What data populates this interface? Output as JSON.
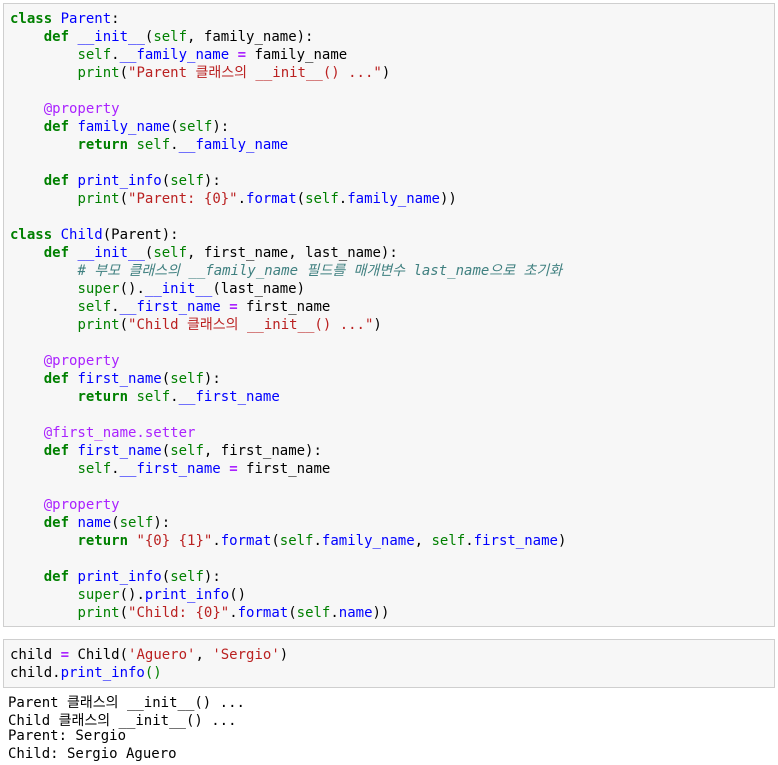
{
  "cells": [
    {
      "lines": [
        [
          [
            "kw",
            "class"
          ],
          [
            "t",
            " "
          ],
          [
            "cls",
            "Parent"
          ],
          [
            "t",
            ":"
          ]
        ],
        [
          [
            "t",
            "    "
          ],
          [
            "kw",
            "def"
          ],
          [
            "t",
            " "
          ],
          [
            "fn",
            "__init__"
          ],
          [
            "t",
            "("
          ],
          [
            "self",
            "self"
          ],
          [
            "t",
            ", family_name):"
          ]
        ],
        [
          [
            "t",
            "        "
          ],
          [
            "self",
            "self"
          ],
          [
            "t",
            "."
          ],
          [
            "attr",
            "__family_name"
          ],
          [
            "t",
            " "
          ],
          [
            "op",
            "="
          ],
          [
            "t",
            " family_name"
          ]
        ],
        [
          [
            "t",
            "        "
          ],
          [
            "bi",
            "print"
          ],
          [
            "t",
            "("
          ],
          [
            "st",
            "\"Parent 클래스의 __init__() ...\""
          ],
          [
            "t",
            ")"
          ]
        ],
        [
          [
            "t",
            ""
          ]
        ],
        [
          [
            "t",
            "    "
          ],
          [
            "dec",
            "@property"
          ]
        ],
        [
          [
            "t",
            "    "
          ],
          [
            "kw",
            "def"
          ],
          [
            "t",
            " "
          ],
          [
            "fn",
            "family_name"
          ],
          [
            "t",
            "("
          ],
          [
            "self",
            "self"
          ],
          [
            "t",
            "):"
          ]
        ],
        [
          [
            "t",
            "        "
          ],
          [
            "kw",
            "return"
          ],
          [
            "t",
            " "
          ],
          [
            "self",
            "self"
          ],
          [
            "t",
            "."
          ],
          [
            "attr",
            "__family_name"
          ]
        ],
        [
          [
            "t",
            ""
          ]
        ],
        [
          [
            "t",
            "    "
          ],
          [
            "kw",
            "def"
          ],
          [
            "t",
            " "
          ],
          [
            "fn",
            "print_info"
          ],
          [
            "t",
            "("
          ],
          [
            "self",
            "self"
          ],
          [
            "t",
            "):"
          ]
        ],
        [
          [
            "t",
            "        "
          ],
          [
            "bi",
            "print"
          ],
          [
            "t",
            "("
          ],
          [
            "st",
            "\"Parent: {0}\""
          ],
          [
            "t",
            "."
          ],
          [
            "attr",
            "format"
          ],
          [
            "t",
            "("
          ],
          [
            "self",
            "self"
          ],
          [
            "t",
            "."
          ],
          [
            "attr",
            "family_name"
          ],
          [
            "t",
            "))"
          ]
        ],
        [
          [
            "t",
            ""
          ]
        ],
        [
          [
            "kw",
            "class"
          ],
          [
            "t",
            " "
          ],
          [
            "cls",
            "Child"
          ],
          [
            "t",
            "(Parent):"
          ]
        ],
        [
          [
            "t",
            "    "
          ],
          [
            "kw",
            "def"
          ],
          [
            "t",
            " "
          ],
          [
            "fn",
            "__init__"
          ],
          [
            "t",
            "("
          ],
          [
            "self",
            "self"
          ],
          [
            "t",
            ", first_name, last_name):"
          ]
        ],
        [
          [
            "t",
            "        "
          ],
          [
            "cm",
            "# 부모 클래스의 __family_name 필드를 매개변수 last_name으로 초기화"
          ]
        ],
        [
          [
            "t",
            "        "
          ],
          [
            "bi",
            "super"
          ],
          [
            "t",
            "()."
          ],
          [
            "attr",
            "__init__"
          ],
          [
            "t",
            "(last_name)"
          ]
        ],
        [
          [
            "t",
            "        "
          ],
          [
            "self",
            "self"
          ],
          [
            "t",
            "."
          ],
          [
            "attr",
            "__first_name"
          ],
          [
            "t",
            " "
          ],
          [
            "op",
            "="
          ],
          [
            "t",
            " first_name"
          ]
        ],
        [
          [
            "t",
            "        "
          ],
          [
            "bi",
            "print"
          ],
          [
            "t",
            "("
          ],
          [
            "st",
            "\"Child 클래스의 __init__() ...\""
          ],
          [
            "t",
            ")"
          ]
        ],
        [
          [
            "t",
            ""
          ]
        ],
        [
          [
            "t",
            "    "
          ],
          [
            "dec",
            "@property"
          ]
        ],
        [
          [
            "t",
            "    "
          ],
          [
            "kw",
            "def"
          ],
          [
            "t",
            " "
          ],
          [
            "fn",
            "first_name"
          ],
          [
            "t",
            "("
          ],
          [
            "self",
            "self"
          ],
          [
            "t",
            "):"
          ]
        ],
        [
          [
            "t",
            "        "
          ],
          [
            "kw",
            "return"
          ],
          [
            "t",
            " "
          ],
          [
            "self",
            "self"
          ],
          [
            "t",
            "."
          ],
          [
            "attr",
            "__first_name"
          ]
        ],
        [
          [
            "t",
            ""
          ]
        ],
        [
          [
            "t",
            "    "
          ],
          [
            "dec",
            "@first_name.setter"
          ]
        ],
        [
          [
            "t",
            "    "
          ],
          [
            "kw",
            "def"
          ],
          [
            "t",
            " "
          ],
          [
            "fn",
            "first_name"
          ],
          [
            "t",
            "("
          ],
          [
            "self",
            "self"
          ],
          [
            "t",
            ", first_name):"
          ]
        ],
        [
          [
            "t",
            "        "
          ],
          [
            "self",
            "self"
          ],
          [
            "t",
            "."
          ],
          [
            "attr",
            "__first_name"
          ],
          [
            "t",
            " "
          ],
          [
            "op",
            "="
          ],
          [
            "t",
            " first_name"
          ]
        ],
        [
          [
            "t",
            ""
          ]
        ],
        [
          [
            "t",
            "    "
          ],
          [
            "dec",
            "@property"
          ]
        ],
        [
          [
            "t",
            "    "
          ],
          [
            "kw",
            "def"
          ],
          [
            "t",
            " "
          ],
          [
            "fn",
            "name"
          ],
          [
            "t",
            "("
          ],
          [
            "self",
            "self"
          ],
          [
            "t",
            "):"
          ]
        ],
        [
          [
            "t",
            "        "
          ],
          [
            "kw",
            "return"
          ],
          [
            "t",
            " "
          ],
          [
            "st",
            "\"{0} {1}\""
          ],
          [
            "t",
            "."
          ],
          [
            "attr",
            "format"
          ],
          [
            "t",
            "("
          ],
          [
            "self",
            "self"
          ],
          [
            "t",
            "."
          ],
          [
            "attr",
            "family_name"
          ],
          [
            "t",
            ", "
          ],
          [
            "self",
            "self"
          ],
          [
            "t",
            "."
          ],
          [
            "attr",
            "first_name"
          ],
          [
            "t",
            ")"
          ]
        ],
        [
          [
            "t",
            ""
          ]
        ],
        [
          [
            "t",
            "    "
          ],
          [
            "kw",
            "def"
          ],
          [
            "t",
            " "
          ],
          [
            "fn",
            "print_info"
          ],
          [
            "t",
            "("
          ],
          [
            "self",
            "self"
          ],
          [
            "t",
            "):"
          ]
        ],
        [
          [
            "t",
            "        "
          ],
          [
            "bi",
            "super"
          ],
          [
            "t",
            "()."
          ],
          [
            "attr",
            "print_info"
          ],
          [
            "t",
            "()"
          ]
        ],
        [
          [
            "t",
            "        "
          ],
          [
            "bi",
            "print"
          ],
          [
            "t",
            "("
          ],
          [
            "st",
            "\"Child: {0}\""
          ],
          [
            "t",
            "."
          ],
          [
            "attr",
            "format"
          ],
          [
            "t",
            "("
          ],
          [
            "self",
            "self"
          ],
          [
            "t",
            "."
          ],
          [
            "attr",
            "name"
          ],
          [
            "t",
            "))"
          ]
        ]
      ]
    },
    {
      "lines": [
        [
          [
            "t",
            "child "
          ],
          [
            "op",
            "="
          ],
          [
            "t",
            " Child("
          ],
          [
            "st",
            "'Aguero'"
          ],
          [
            "t",
            ", "
          ],
          [
            "st",
            "'Sergio'"
          ],
          [
            "t",
            ")"
          ]
        ],
        [
          [
            "t",
            "child."
          ],
          [
            "attr",
            "print_info"
          ],
          [
            "bi",
            "()"
          ]
        ]
      ]
    }
  ],
  "output": [
    "Parent 클래스의 __init__() ...",
    "Child 클래스의 __init__() ...",
    "Parent: Sergio",
    "Child: Sergio Aguero"
  ],
  "colors": {
    "keyword": "#008000",
    "name": "#0000ff",
    "operator": "#aa22ff",
    "string": "#ba2121",
    "comment": "#408080",
    "cell_bg": "#f7f7f7",
    "cell_border": "#cfcfcf"
  }
}
